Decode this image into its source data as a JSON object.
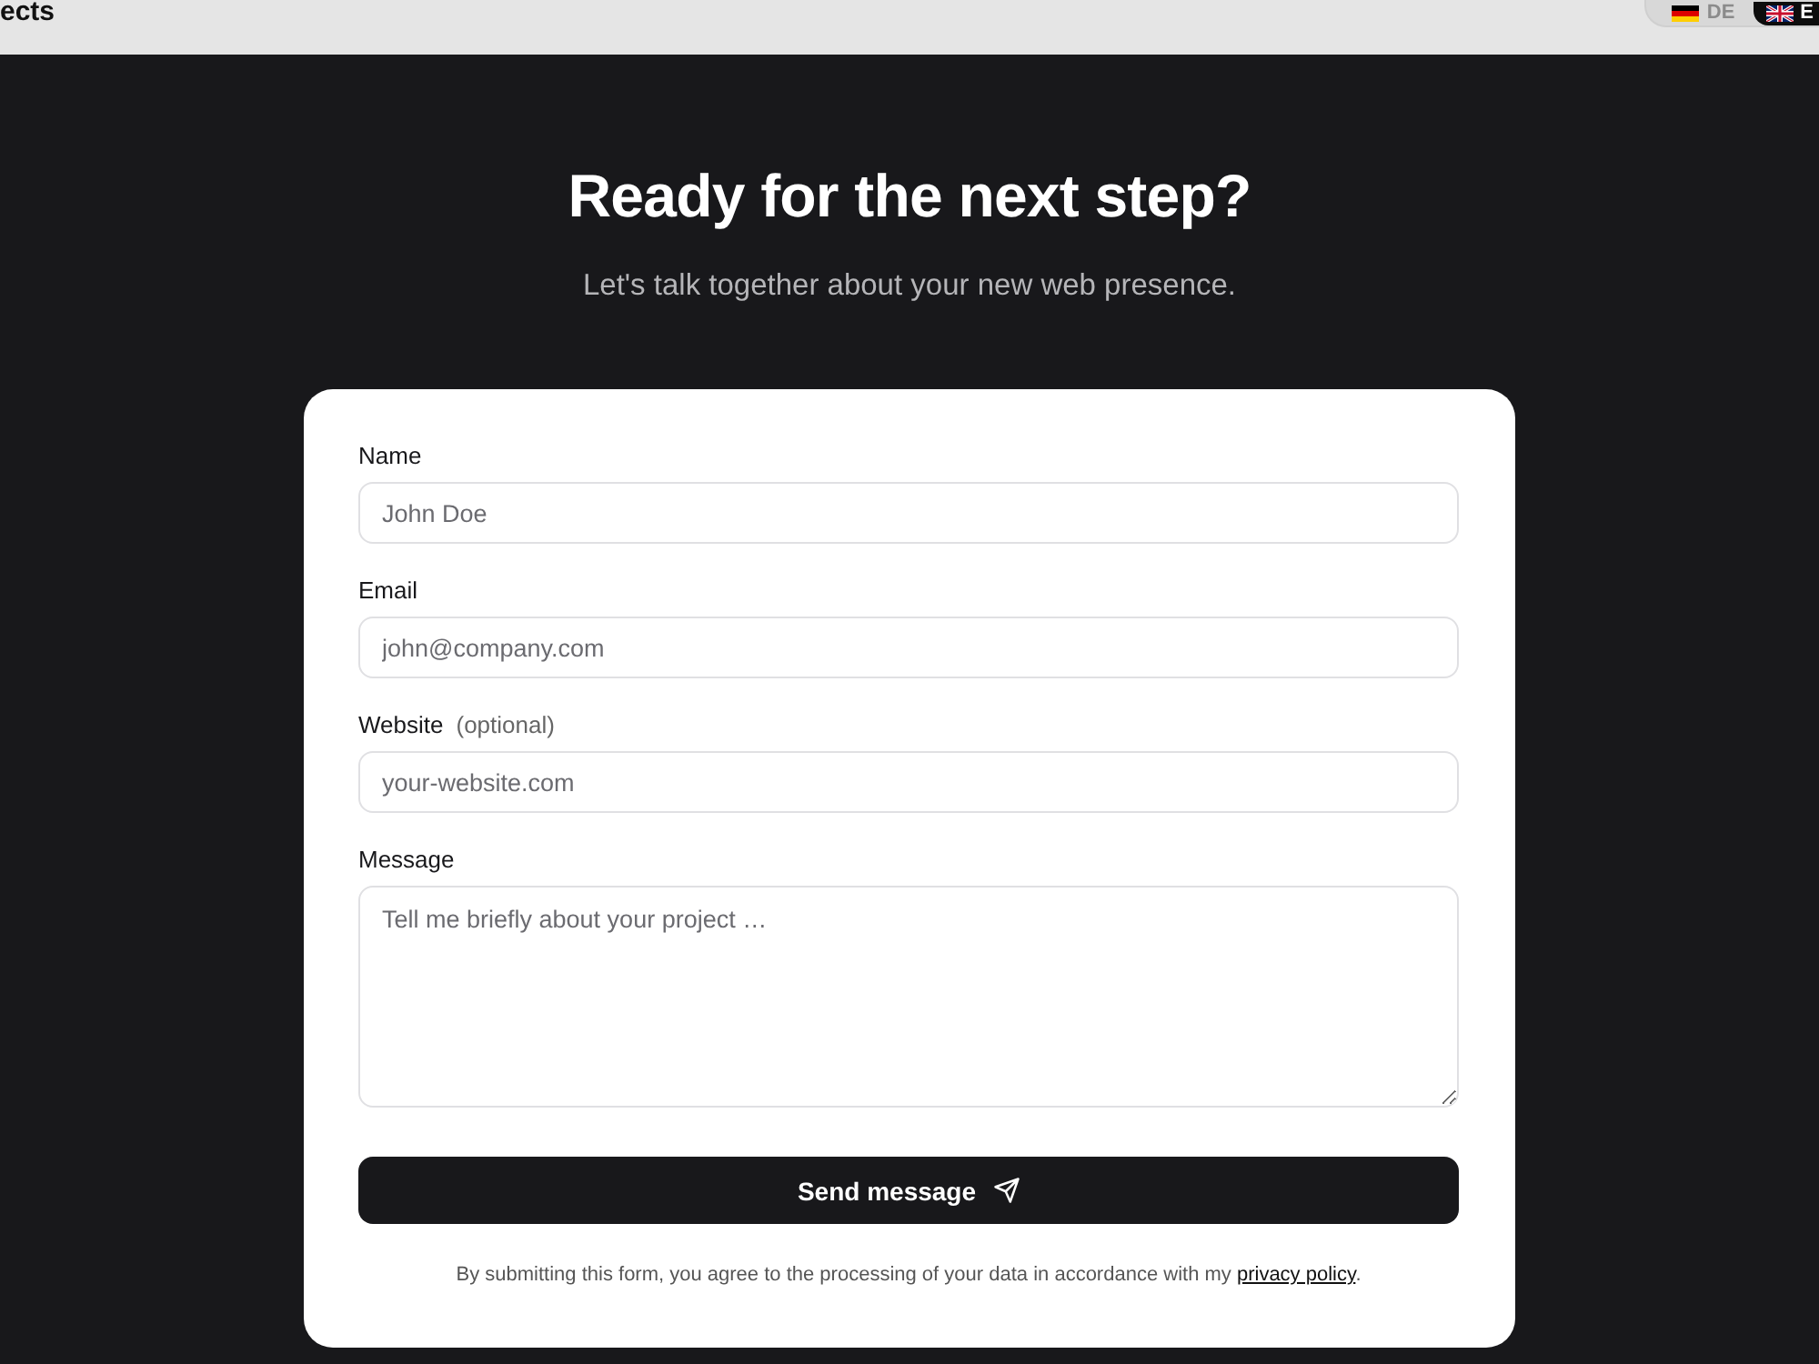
{
  "top_bar": {
    "nav_text": "ects",
    "languages": [
      {
        "kind": "de",
        "label": "DE",
        "selected": false
      },
      {
        "kind": "gb",
        "label": "E",
        "selected": true
      }
    ]
  },
  "hero": {
    "title": "Ready for the next step?",
    "subtitle": "Let's talk together about your new web presence."
  },
  "form": {
    "fields": [
      {
        "kind": "input",
        "label": "Name",
        "placeholder": "John Doe"
      },
      {
        "kind": "input",
        "label": "Email",
        "placeholder": "john@company.com"
      },
      {
        "kind": "input",
        "label": "Website",
        "note": "(optional)",
        "placeholder": "your-website.com"
      },
      {
        "kind": "textarea",
        "label": "Message",
        "placeholder": "Tell me briefly about your project …"
      }
    ],
    "submit": {
      "label": "Send message"
    },
    "consent": {
      "text": "By submitting this form, you agree to the processing of your data in accordance with my",
      "link": "privacy policy",
      "end": "."
    }
  }
}
